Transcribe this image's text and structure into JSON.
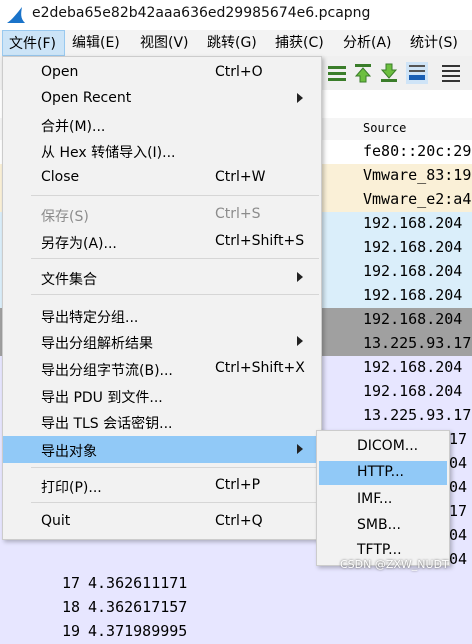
{
  "window": {
    "title": "e2deba65e82b42aaa636ed29985674e6.pcapng"
  },
  "menubar": {
    "items": [
      {
        "label": "文件(F)"
      },
      {
        "label": "编辑(E)"
      },
      {
        "label": "视图(V)"
      },
      {
        "label": "跳转(G)"
      },
      {
        "label": "捕获(C)"
      },
      {
        "label": "分析(A)"
      },
      {
        "label": "统计(S)"
      }
    ]
  },
  "packet_list": {
    "column_source": "Source",
    "rows": [
      {
        "src": "fe80::20c:29",
        "bg": "#ffffff"
      },
      {
        "src": "Vmware_83:19",
        "bg": "#faf0d7"
      },
      {
        "src": "Vmware_e2:a4",
        "bg": "#faf0d7"
      },
      {
        "src": "192.168.204",
        "bg": "#daeefa"
      },
      {
        "src": "192.168.204",
        "bg": "#daeefa"
      },
      {
        "src": "192.168.204",
        "bg": "#daeefa"
      },
      {
        "src": "192.168.204",
        "bg": "#daeefa"
      },
      {
        "src": "192.168.204",
        "bg": "#a0a0a0"
      },
      {
        "src": "13.225.93.17",
        "bg": "#a0a0a0"
      },
      {
        "src": "192.168.204",
        "bg": "#e7e6ff"
      },
      {
        "src": "192.168.204",
        "bg": "#e7e6ff"
      },
      {
        "src": "13.225.93.17",
        "bg": "#e7e6ff"
      },
      {
        "src": "",
        "bg": "#e7e6ff",
        "tail": "17"
      },
      {
        "src": "",
        "bg": "#e7e6ff",
        "tail": "04"
      },
      {
        "src": "",
        "bg": "#e7e6ff",
        "tail": "04"
      },
      {
        "src": "",
        "bg": "#e7e6ff",
        "tail": "17"
      },
      {
        "src": "",
        "bg": "#e7e6ff",
        "tail": "04"
      },
      {
        "src": "",
        "bg": "#e7e6ff",
        "tail": "04"
      },
      {
        "num": "17",
        "time": "4.362611171",
        "src": "",
        "bg": "#e7e6ff",
        "tail": ""
      },
      {
        "num": "18",
        "time": "4.362617157",
        "src": "",
        "bg": "#e7e6ff",
        "tail": ""
      },
      {
        "num": "19",
        "time": "4.371989995",
        "src": "",
        "bg": "#e7e6ff",
        "tail": ""
      }
    ]
  },
  "file_menu": {
    "items": [
      {
        "label": "Open",
        "shortcut": "Ctrl+O"
      },
      {
        "label": "Open Recent",
        "submenu": true
      },
      {
        "label": "合并(M)..."
      },
      {
        "label": "从 Hex 转储导入(I)..."
      },
      {
        "label": "Close",
        "shortcut": "Ctrl+W"
      },
      {
        "label": "保存(S)",
        "shortcut": "Ctrl+S",
        "disabled": true
      },
      {
        "label": "另存为(A)...",
        "shortcut": "Ctrl+Shift+S"
      },
      {
        "label": "文件集合",
        "submenu": true
      },
      {
        "label": "导出特定分组..."
      },
      {
        "label": "导出分组解析结果",
        "submenu": true
      },
      {
        "label": "导出分组字节流(B)...",
        "shortcut": "Ctrl+Shift+X"
      },
      {
        "label": "导出 PDU 到文件..."
      },
      {
        "label": "导出 TLS 会话密钥..."
      },
      {
        "label": "导出对象",
        "submenu": true,
        "highlighted": true
      },
      {
        "label": "打印(P)...",
        "shortcut": "Ctrl+P"
      },
      {
        "label": "Quit",
        "shortcut": "Ctrl+Q"
      }
    ]
  },
  "export_objects_menu": {
    "items": [
      {
        "label": "DICOM..."
      },
      {
        "label": "HTTP...",
        "highlighted": true
      },
      {
        "label": "IMF..."
      },
      {
        "label": "SMB..."
      },
      {
        "label": "TFTP..."
      }
    ]
  },
  "watermark": "CSDN @ZXW_NUDT",
  "colors": {
    "highlight": "#91c9f7",
    "menu_bg": "#f2f2f2",
    "menubar_active": "#cce4f7"
  }
}
